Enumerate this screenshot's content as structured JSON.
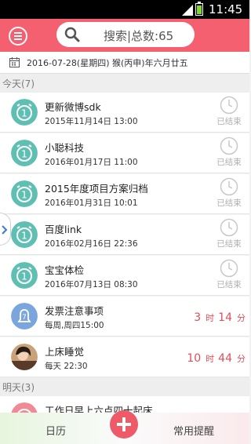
{
  "status_bar": {
    "time": "11:45"
  },
  "header": {
    "search_text": "搜索|总数:65"
  },
  "date_bar": {
    "text": "2016-07-28(星期四)   猴(丙申)年六月廿五"
  },
  "sections": {
    "today": "今天(7)",
    "tomorrow": "明天(3)"
  },
  "items": [
    {
      "title": "更新微博sdk",
      "sub": "2015年11月14日 13:00",
      "status": "已结束",
      "icon": "alarm-clock-icon",
      "badge": "1"
    },
    {
      "title": "小聪科技",
      "sub": "2016年01月17日 11:00",
      "status": "已结束",
      "icon": "alarm-clock-icon",
      "badge": "1"
    },
    {
      "title": "2015年度项目方案归档",
      "sub": "2016年01月31日 10:01",
      "status": "已结束",
      "icon": "alarm-clock-icon",
      "badge": "1"
    },
    {
      "title": "百度link",
      "sub": "2016年02月16日 22:36",
      "status": "已结束",
      "icon": "alarm-clock-icon",
      "badge": "1"
    },
    {
      "title": "宝宝体检",
      "sub": "2016年07月13日 08:30",
      "status": "已结束",
      "icon": "alarm-clock-icon",
      "badge": "1"
    },
    {
      "title": "发票注意事项",
      "sub": "每周,周四15:00",
      "icon": "bell-icon",
      "badge": "7",
      "countdown": {
        "hours": "3",
        "hour_unit": "时",
        "minutes": "14",
        "minute_unit": "分"
      }
    },
    {
      "title": "上床睡觉",
      "sub": "每天 22:30",
      "icon": "avatar-photo",
      "countdown": {
        "hours": "10",
        "hour_unit": "时",
        "minutes": "44",
        "minute_unit": "分"
      }
    },
    {
      "title": "工作日早上六点四十起床",
      "icon": "alarm-clock-icon"
    }
  ],
  "bottom_bar": {
    "left_tab": "日历",
    "right_tab": "常用提醒"
  },
  "colors": {
    "accent": "#f4606f",
    "teal": "#5fbfb3",
    "countdown": "#e24d5a",
    "bell_blue": "#7aa6dd"
  }
}
